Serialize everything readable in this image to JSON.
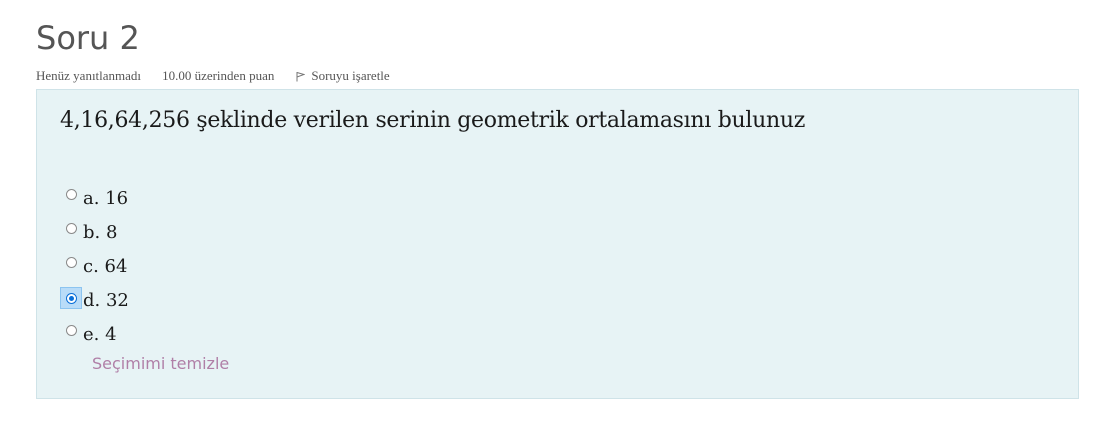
{
  "question": {
    "heading": "Soru 2",
    "status": "Henüz yanıtlanmadı",
    "grade": "10.00 üzerinden puan",
    "flag_label": "Soruyu işaretle",
    "text": "4,16,64,256 şeklinde verilen serinin geometrik ortalamasını bulunuz",
    "options": [
      {
        "label": "a. 16",
        "selected": false
      },
      {
        "label": "b. 8",
        "selected": false
      },
      {
        "label": "c. 64",
        "selected": false
      },
      {
        "label": "d. 32",
        "selected": true
      },
      {
        "label": "e. 4",
        "selected": false
      }
    ],
    "clear_label": "Seçimimi temizle"
  },
  "colors": {
    "box_bg": "#e7f3f5",
    "box_border": "#cfe3e8",
    "accent": "#0a6fd8",
    "link": "#b07fa7"
  },
  "icons": {
    "flag": "flag-icon"
  }
}
